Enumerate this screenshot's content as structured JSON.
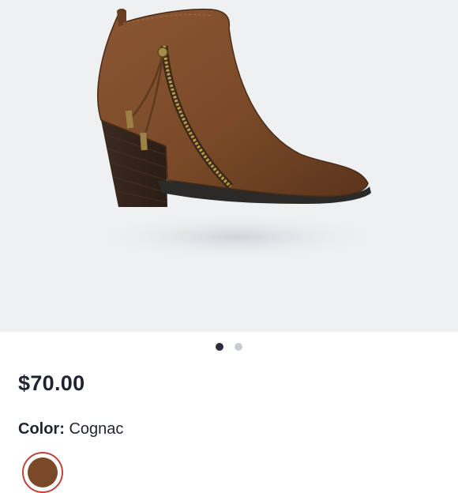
{
  "listing": {
    "price": "$70.00",
    "color_label": "Color:",
    "color_value": "Cognac"
  },
  "carousel": {
    "image_count": 2,
    "active_index": 0
  },
  "colors": {
    "hero_background": "#eef0f2",
    "active_dot": "#2a2f3a",
    "inactive_dot": "#c9ccd1",
    "boot_leather": "#7a4a28",
    "swatch_ring": "#c2413a"
  }
}
